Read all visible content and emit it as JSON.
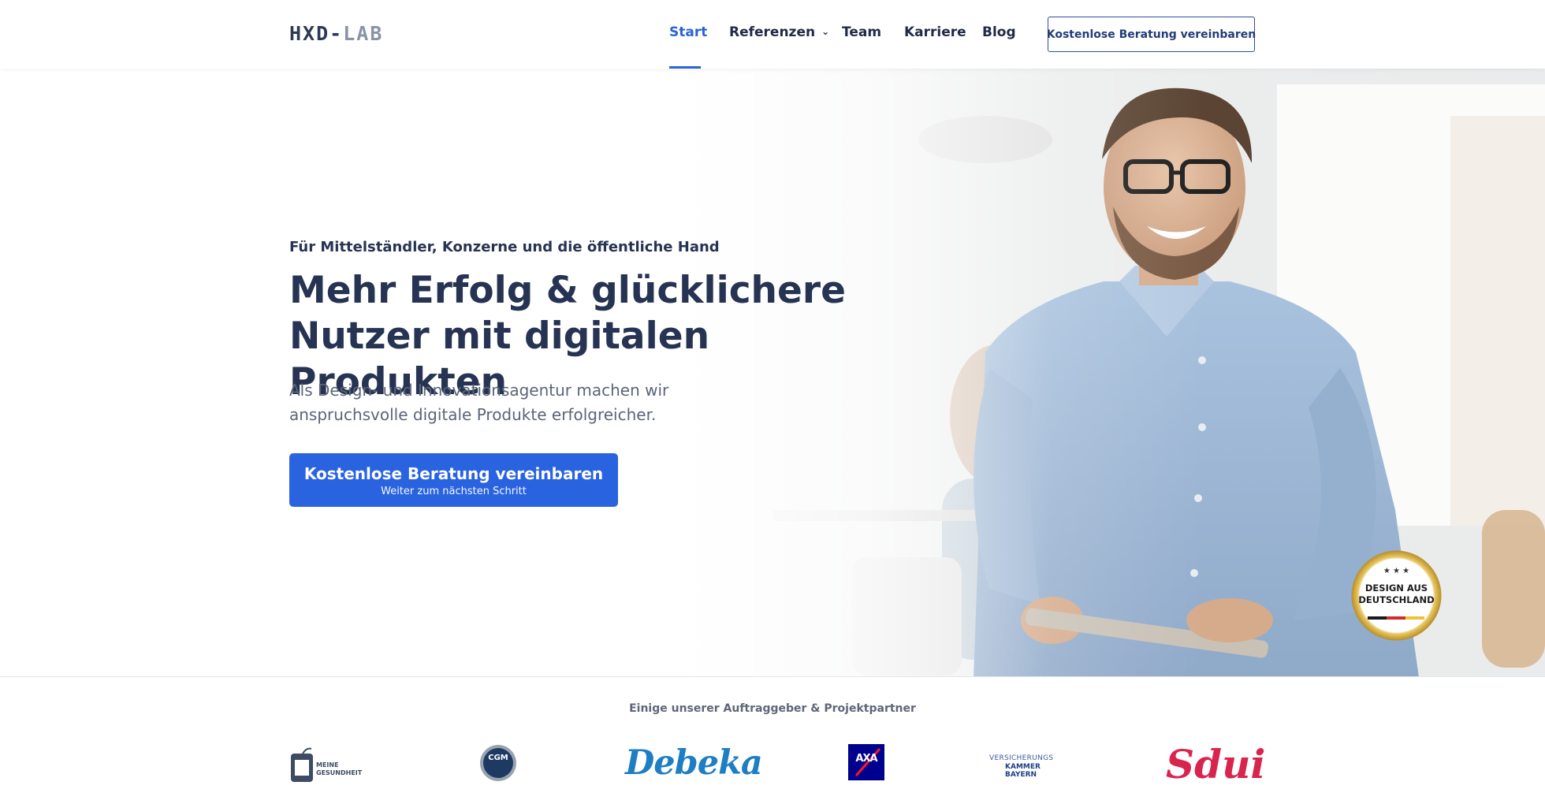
{
  "brand": {
    "logo_primary": "HXD-",
    "logo_secondary": "LAB"
  },
  "nav": {
    "items": [
      {
        "label": "Start",
        "active": true
      },
      {
        "label": "Referenzen",
        "has_dropdown": true
      },
      {
        "label": "Team"
      },
      {
        "label": "Karriere"
      },
      {
        "label": "Blog"
      }
    ],
    "cta_label": "Kostenlose Beratung vereinbaren"
  },
  "hero": {
    "eyebrow": "Für Mittelständler, Konzerne und die öffentliche Hand",
    "headline_line1": "Mehr Erfolg & glücklichere",
    "headline_line2": "Nutzer mit digitalen Produkten",
    "subline_line1": "Als Design- und Innovationsagentur machen wir",
    "subline_line2": "anspruchsvolle digitale Produkte erfolgreicher.",
    "cta_label": "Kostenlose Beratung vereinbaren",
    "cta_sublabel": "Weiter zum nächsten Schritt",
    "seal_line1": "DESIGN AUS",
    "seal_line2": "DEUTSCHLAND"
  },
  "partners": {
    "title": "Einige unserer Auftraggeber & Projektpartner",
    "logos": [
      {
        "name": "meine-gesundheit",
        "line1": "MEINE",
        "line2": "GESUNDHEIT"
      },
      {
        "name": "cgm",
        "text": "CGM"
      },
      {
        "name": "debeka",
        "text": "Debeka"
      },
      {
        "name": "axa",
        "text": "AXA"
      },
      {
        "name": "versicherungskammer-bayern",
        "top": "VERSICHERUNGS",
        "line1": "KAMMER",
        "line2": "BAYERN"
      },
      {
        "name": "sdui",
        "text": "Sdui"
      }
    ]
  },
  "colors": {
    "accent": "#2a63e0",
    "nav_active": "#2a63d6",
    "text_dark": "#263352",
    "debeka": "#1e7ec3",
    "axa": "#00008f",
    "sdui": "#d9244e"
  }
}
